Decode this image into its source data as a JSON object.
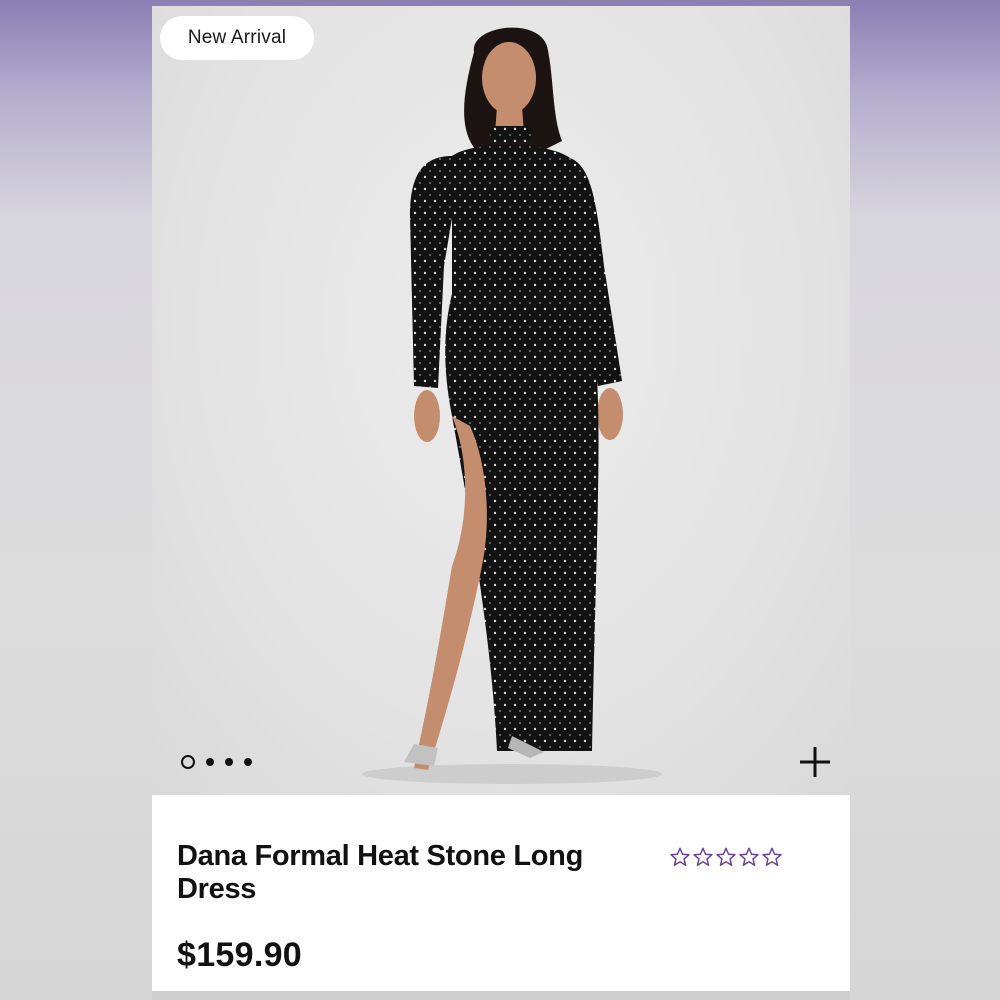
{
  "product": {
    "badge": "New Arrival",
    "title": "Dana Formal Heat Stone Long Dress",
    "price": "$159.90",
    "rating": {
      "value": 0,
      "max": 5,
      "star_color": "#6b3fa0"
    },
    "image_alt": "Model wearing black long-sleeve rhinestone gown with high leg slit and silver heels"
  },
  "carousel": {
    "slide_count": 4,
    "active_slide": 1
  },
  "icons": {
    "add": "plus-icon",
    "rating": "star-outline-icon"
  },
  "colors": {
    "accent": "#6b3fa0",
    "text": "#111111"
  }
}
